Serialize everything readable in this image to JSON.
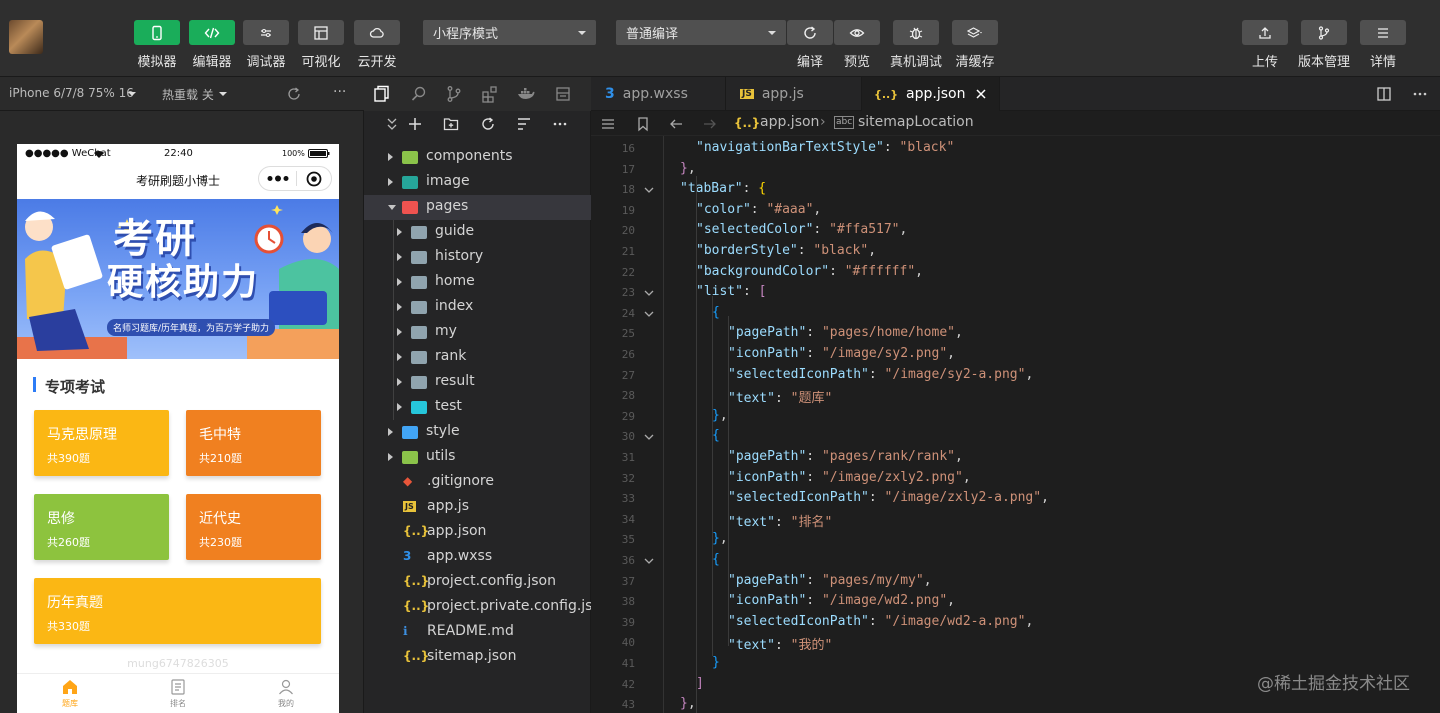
{
  "toolbar": {
    "simulator": "模拟器",
    "editor": "编辑器",
    "debugger": "调试器",
    "visual": "可视化",
    "cloud": "云开发",
    "mode_select": "小程序模式",
    "compile_select": "普通编译",
    "compile": "编译",
    "preview": "预览",
    "real_debug": "真机调试",
    "clear_cache": "清缓存",
    "upload": "上传",
    "version": "版本管理",
    "details": "详情"
  },
  "simbar": {
    "device": "iPhone 6/7/8 75% 16",
    "hot_reload": "热重载 关",
    "more": "···"
  },
  "phone": {
    "carrier": "●●●●● WeChat",
    "time": "22:40",
    "battery": "100%",
    "title": "考研刷题小博士",
    "banner_title_1": "考研",
    "banner_title_2": "硬核助力",
    "banner_sub": "名师习题库/历年真题，为百万学子助力",
    "section_title": "专项考试",
    "cards": [
      {
        "name": "马克思原理",
        "count": "共390题",
        "color": "#fbb714"
      },
      {
        "name": "毛中特",
        "count": "共210题",
        "color": "#f08020"
      },
      {
        "name": "思修",
        "count": "共260题",
        "color": "#8dc33e"
      },
      {
        "name": "近代史",
        "count": "共230题",
        "color": "#f08020"
      },
      {
        "name": "历年真题",
        "count": "共330题",
        "color": "#fbb714"
      }
    ],
    "watermark": "mung6747826305",
    "tabs": [
      {
        "label": "题库",
        "active_color": "#ffa517"
      },
      {
        "label": "排名"
      },
      {
        "label": "我的"
      }
    ]
  },
  "explorer": {
    "items": [
      {
        "name": "components",
        "type": "folder",
        "color": "#8bc34a"
      },
      {
        "name": "image",
        "type": "folder",
        "color": "#26a69a"
      },
      {
        "name": "pages",
        "type": "folder-open",
        "color": "#ef5350"
      },
      {
        "name": "guide",
        "type": "folder",
        "color": "#90a4ae"
      },
      {
        "name": "history",
        "type": "folder",
        "color": "#90a4ae"
      },
      {
        "name": "home",
        "type": "folder",
        "color": "#90a4ae"
      },
      {
        "name": "index",
        "type": "folder",
        "color": "#90a4ae"
      },
      {
        "name": "my",
        "type": "folder",
        "color": "#90a4ae"
      },
      {
        "name": "rank",
        "type": "folder",
        "color": "#90a4ae"
      },
      {
        "name": "result",
        "type": "folder",
        "color": "#90a4ae"
      },
      {
        "name": "test",
        "type": "folder",
        "color": "#26c6da"
      },
      {
        "name": "style",
        "type": "folder",
        "color": "#42a5f5"
      },
      {
        "name": "utils",
        "type": "folder",
        "color": "#8bc34a"
      },
      {
        "name": ".gitignore",
        "type": "file"
      },
      {
        "name": "app.js",
        "type": "file"
      },
      {
        "name": "app.json",
        "type": "file"
      },
      {
        "name": "app.wxss",
        "type": "file"
      },
      {
        "name": "project.config.json",
        "type": "file"
      },
      {
        "name": "project.private.config.js...",
        "type": "file"
      },
      {
        "name": "README.md",
        "type": "file"
      },
      {
        "name": "sitemap.json",
        "type": "file"
      }
    ]
  },
  "editor": {
    "tabs": [
      {
        "label": "app.wxss",
        "icon": "css-icon"
      },
      {
        "label": "app.js",
        "icon": "js-icon"
      },
      {
        "label": "app.json",
        "icon": "json-icon"
      }
    ],
    "breadcrumb_file": "app.json",
    "breadcrumb_symbol": "sitemapLocation",
    "line_numbers": [
      "16",
      "17",
      "18",
      "19",
      "20",
      "21",
      "22",
      "23",
      "24",
      "25",
      "26",
      "27",
      "28",
      "29",
      "30",
      "31",
      "32",
      "33",
      "34",
      "35",
      "36",
      "37",
      "38",
      "39",
      "40",
      "41",
      "42",
      "43"
    ],
    "lines": [
      "\"navigationBarTextStyle\": \"black\"",
      "},",
      "\"tabBar\": {",
      "\"color\": \"#aaa\",",
      "\"selectedColor\": \"#ffa517\",",
      "\"borderStyle\": \"black\",",
      "\"backgroundColor\": \"#ffffff\",",
      "\"list\": [",
      "{",
      "\"pagePath\": \"pages/home/home\",",
      "\"iconPath\": \"/image/sy2.png\",",
      "\"selectedIconPath\": \"/image/sy2-a.png\",",
      "\"text\": \"题库\"",
      "},",
      "{",
      "\"pagePath\": \"pages/rank/rank\",",
      "\"iconPath\": \"/image/zxly2.png\",",
      "\"selectedIconPath\": \"/image/zxly2-a.png\",",
      "\"text\": \"排名\"",
      "},",
      "{",
      "\"pagePath\": \"pages/my/my\",",
      "\"iconPath\": \"/image/wd2.png\",",
      "\"selectedIconPath\": \"/image/wd2-a.png\",",
      "\"text\": \"我的\"",
      "}",
      "]",
      "},"
    ],
    "watermark": "@稀土掘金技术社区"
  }
}
